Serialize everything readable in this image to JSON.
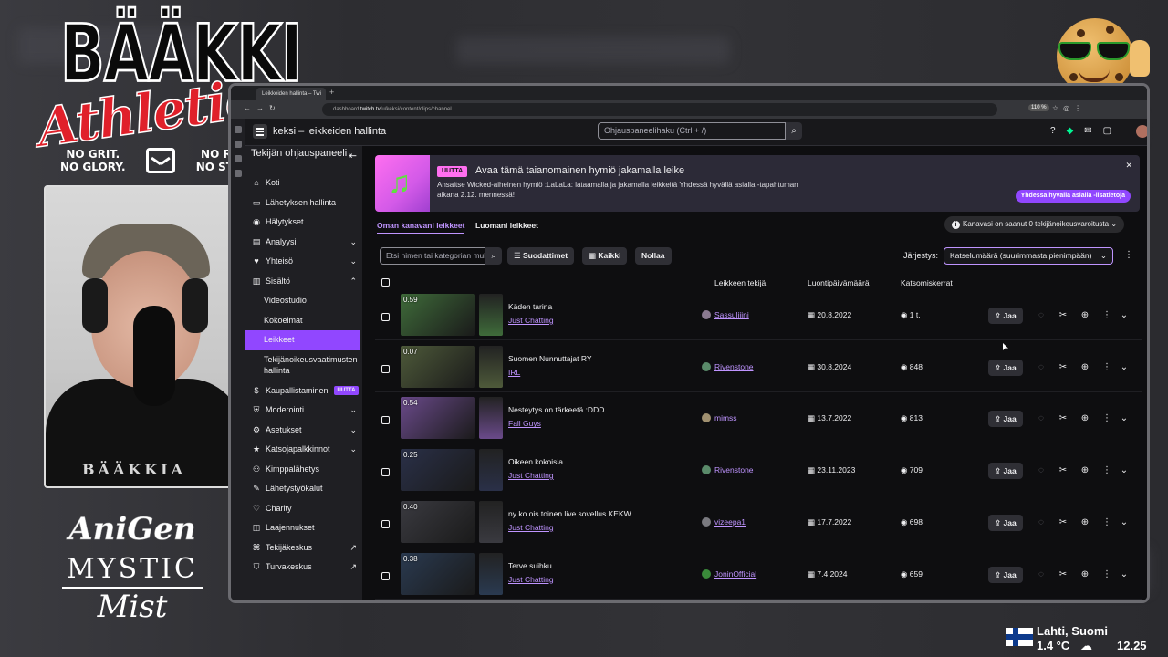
{
  "overlay": {
    "brand_top": "BÄÄKKI",
    "brand_script": "Athletics",
    "brand_left": [
      "NO GRIT.",
      "NO GLORY."
    ],
    "brand_right": [
      "NO RISK.",
      "NO STORY."
    ],
    "shirt_text": "BÄÄKKIA",
    "sponsor_1": "AniGen",
    "sponsor_2": "MYSTIC",
    "sponsor_3": "Mist",
    "weather_city": "Lahti, Suomi",
    "weather_temp": "1.4 °C",
    "weather_icon": "cloud-snow-icon",
    "clock": "12.25"
  },
  "browser": {
    "tab_title": "Leikkeiden hallinta – Twi",
    "url_prefix": "dashboard.",
    "url_domain": "twitch.tv",
    "url_rest": "/u/keksi/content/clips/channel",
    "zoom": "110 %"
  },
  "header": {
    "title": "keksi – leikkeiden hallinta",
    "search_placeholder": "Ohjauspaneelihaku (Ctrl + /)"
  },
  "sidebar": {
    "heading": "Tekijän ohjauspaneeli",
    "items": [
      {
        "label": "Koti",
        "icon": "home-icon"
      },
      {
        "label": "Lähetyksen hallinta",
        "icon": "broadcast-icon"
      },
      {
        "label": "Hälytykset",
        "icon": "alert-icon"
      },
      {
        "label": "Analyysi",
        "icon": "analytics-icon"
      },
      {
        "label": "Yhteisö",
        "icon": "community-icon"
      },
      {
        "label": "Sisältö",
        "icon": "content-icon"
      },
      {
        "label": "Videostudio"
      },
      {
        "label": "Kokoelmat"
      },
      {
        "label": "Leikkeet"
      },
      {
        "label": "Tekijänoikeusvaatimusten hallinta"
      },
      {
        "label": "Kaupallistaminen",
        "icon": "monetization-icon",
        "badge": "UUTTA"
      },
      {
        "label": "Moderointi",
        "icon": "moderation-icon"
      },
      {
        "label": "Asetukset",
        "icon": "settings-icon"
      },
      {
        "label": "Katsojapalkkinnot",
        "icon": "rewards-icon"
      },
      {
        "label": "Kimppalähetys",
        "icon": "collab-icon"
      },
      {
        "label": "Lähetystyökalut",
        "icon": "tools-icon"
      },
      {
        "label": "Charity",
        "icon": "charity-icon"
      },
      {
        "label": "Laajennukset",
        "icon": "extensions-icon"
      },
      {
        "label": "Tekijäkeskus",
        "icon": "creator-camp-icon"
      },
      {
        "label": "Turvakeskus",
        "icon": "safety-icon"
      }
    ]
  },
  "banner": {
    "tag": "UUTTA",
    "title": "Avaa tämä taianomainen hymiö jakamalla leike",
    "text": "Ansaitse Wicked-aiheinen hymiö :LaLaLa: lataamalla ja jakamalla leikkeitä Yhdessä hyvällä asialla -tapahtuman aikana 2.12. mennessä!",
    "cta": "Yhdessä hyvällä asialla -lisätietoja"
  },
  "tabs": {
    "channel_clips": "Oman kanavani leikkeet",
    "my_clips": "Luomani leikkeet",
    "warning": "Kanavasi on saanut 0 tekijänoikeusvaroitusta"
  },
  "toolbar": {
    "filter_placeholder": "Etsi nimen tai kategorian mukaan",
    "filters": "Suodattimet",
    "all": "Kaikki",
    "reset": "Nollaa",
    "sort_label": "Järjestys:",
    "sort_value": "Katselumäärä (suurimmasta pienimpään)"
  },
  "table": {
    "headers": {
      "creator": "Leikkeen tekijä",
      "date": "Luontipäivämäärä",
      "views": "Katsomiskerrat"
    },
    "share_label": "Jaa",
    "rows": [
      {
        "duration": "0.59",
        "title": "Käden tarina",
        "category": "Just Chatting",
        "creator": "Sassuliiini",
        "date": "20.8.2022",
        "views": "1 t.",
        "thumb_color": "#3f6b3a"
      },
      {
        "duration": "0.07",
        "title": "Suomen Nunnuttajat RY",
        "category": "IRL",
        "creator": "Rivenstone",
        "date": "30.8.2024",
        "views": "848",
        "thumb_color": "#4e5a3a"
      },
      {
        "duration": "0.54",
        "title": "Nesteytys on tärkeetä :DDD",
        "category": "Fall Guys",
        "creator": "mimss",
        "date": "13.7.2022",
        "views": "813",
        "thumb_color": "#6a4a8a"
      },
      {
        "duration": "0.25",
        "title": "Oikeen kokoisia",
        "category": "Just Chatting",
        "creator": "Rivenstone",
        "date": "23.11.2023",
        "views": "709",
        "thumb_color": "#2a3048"
      },
      {
        "duration": "0.40",
        "title": "ny ko ois toinen live sovellus KEKW",
        "category": "Just Chatting",
        "creator": "vizeepa1",
        "date": "17.7.2022",
        "views": "698",
        "thumb_color": "#3a3a40"
      },
      {
        "duration": "0.38",
        "title": "Terve suihku",
        "category": "Just Chatting",
        "creator": "JoninOfficial",
        "date": "7.4.2024",
        "views": "659",
        "thumb_color": "#2a3a50"
      }
    ]
  },
  "colors": {
    "accent": "#9147ff",
    "accent_light": "#bf94ff",
    "bg": "#0e0e10",
    "sidebar_bg": "#1f1f23"
  }
}
